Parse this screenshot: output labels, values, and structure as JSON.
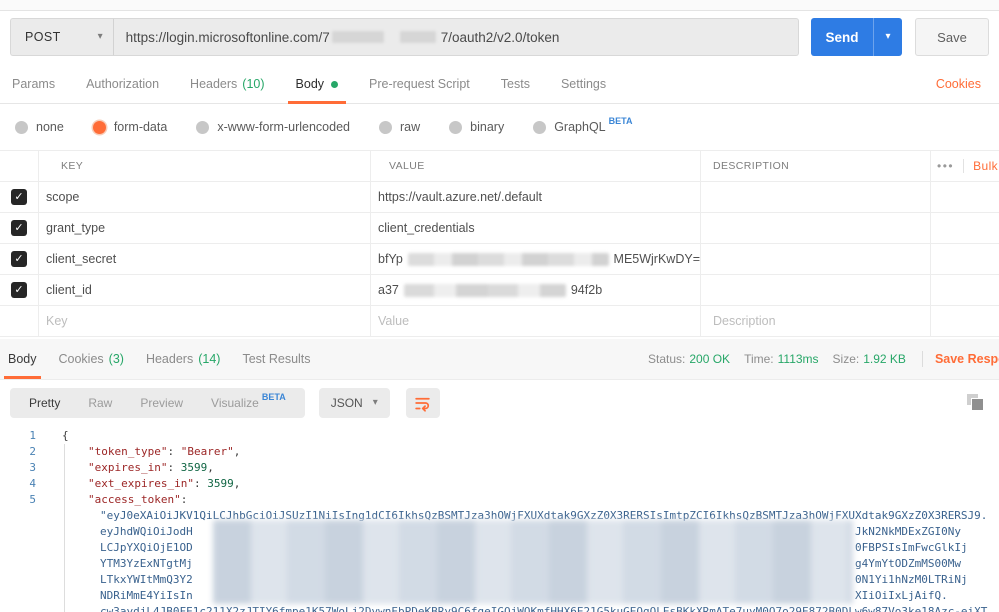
{
  "colors": {
    "accent": "#ff6c37",
    "success_green": "#27a768",
    "send_blue": "#2e7ce4",
    "beta_blue": "#3b86d6"
  },
  "icons": {
    "caret": "▾",
    "more": "•••",
    "check": "✓"
  },
  "topbar": {
    "method": "POST",
    "url_prefix": "https://login.microsoftonline.com/7",
    "url_suffix": "7/oauth2/v2.0/token",
    "send": "Send",
    "save": "Save"
  },
  "request_tabs": {
    "items": [
      {
        "label": "Params"
      },
      {
        "label": "Authorization"
      },
      {
        "label": "Headers",
        "count": "(10)"
      },
      {
        "label": "Body"
      },
      {
        "label": "Pre-request Script"
      },
      {
        "label": "Tests"
      },
      {
        "label": "Settings"
      }
    ],
    "cookies": "Cookies"
  },
  "body_modes": {
    "options": [
      "none",
      "form-data",
      "x-www-form-urlencoded",
      "raw",
      "binary",
      "GraphQL"
    ],
    "beta": "BETA",
    "selected": "form-data"
  },
  "body_table": {
    "headers": {
      "key": "KEY",
      "value": "VALUE",
      "description": "DESCRIPTION"
    },
    "bulk_edit": "Bulk Edit",
    "rows": [
      {
        "key": "scope",
        "value": "https://vault.azure.net/.default"
      },
      {
        "key": "grant_type",
        "value": "client_credentials"
      },
      {
        "key": "client_secret",
        "value_prefix": "bfYp",
        "value_suffix": "ME5WjrKwDY="
      },
      {
        "key": "client_id",
        "value_prefix": "a37",
        "value_suffix": "94f2b"
      }
    ],
    "placeholder": {
      "key": "Key",
      "value": "Value",
      "description": "Description"
    }
  },
  "response": {
    "tabs": [
      {
        "label": "Body"
      },
      {
        "label": "Cookies",
        "count": "(3)"
      },
      {
        "label": "Headers",
        "count": "(14)"
      },
      {
        "label": "Test Results"
      }
    ],
    "status_label": "Status:",
    "status_value": "200 OK",
    "time_label": "Time:",
    "time_value": "1113ms",
    "size_label": "Size:",
    "size_value": "1.92 KB",
    "save_response": "Save Response"
  },
  "viewer": {
    "views": [
      "Pretty",
      "Raw",
      "Preview",
      "Visualize"
    ],
    "active_view": "Pretty",
    "beta": "BETA",
    "format": "JSON"
  },
  "code": {
    "gutter": [
      "1",
      "2",
      "3",
      "4",
      "5"
    ],
    "l1": "{",
    "colon": ": ",
    "comma": ",",
    "l2_key": "\"token_type\"",
    "l2_val": "\"Bearer\"",
    "l3_key": "\"expires_in\"",
    "l3_num": "3599",
    "l4_key": "\"ext_expires_in\"",
    "l4_num": "3599",
    "l5_key": "\"access_token\"",
    "t1": "\"eyJ0eXAiOiJKV1QiLCJhbGciOiJSUzI1NiIsIng1dCI6IkhsQzBSMTJza3hOWjFXUXdtak9GXzZ0X3RERSIsImtpZCI6IkhsQzBSMTJza3hOWjFXUXdtak9GXzZ0X3RERSJ9.",
    "t2_left": "eyJhdWQiOiJodH",
    "t2_right": "JkN2NkMDExZGI0Ny",
    "t3_left": "LCJpYXQiOjE1OD",
    "t3_right": "0FBPSIsImFwcGlkIj",
    "t4_left": "YTM3YzExNTgtMj",
    "t4_right": "g4YmYtODZmMS00Mw",
    "t5_left": "LTkxYWItMmQ3Y2",
    "t5_right": "0N1Yi1hNzM0LTRiNj",
    "t6_left": "NDRiMmE4YiIsIn",
    "t6_right": "XIiOiIxLjAifQ.",
    "t7": "cw3aydjL4JB0FE1c211X2zJTIY6fmpe1K57WoLj2DvwnEbPDeKBRy9C6fgeIGQjWOKmfHHX6E21G5kuGEOgQLEsBKkXRmATe7uyM0O7o29E872B0DLw6w87Vo3ke18Azc-eiXT"
  }
}
